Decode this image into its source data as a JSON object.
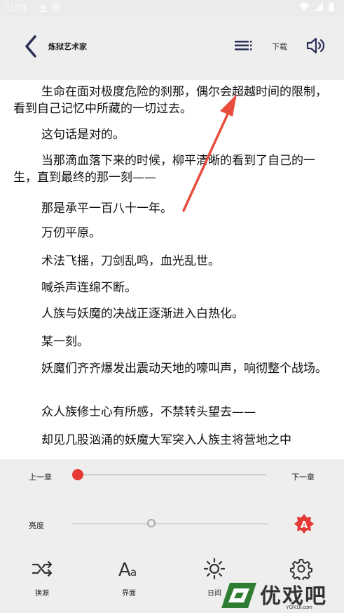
{
  "status_bar": {
    "time": "11:23"
  },
  "header": {
    "title": "炼狱艺术家",
    "download_label": "下载"
  },
  "content": {
    "paragraphs": [
      "生命在面对极度危险的刹那，偶尔会超越时间的限制，看到自己记忆中所藏的一切过去。",
      "这句话是对的。",
      "当那滴血落下来的时候，柳平清晰的看到了自己的一生，直到最终的那一刻——",
      "那是承平一百八十一年。",
      "万仞平原。",
      "术法飞摇，刀剑乱鸣，血光乱世。",
      "喊杀声连绵不断。",
      "人族与妖魔的决战正逐渐进入白热化。",
      "某一刻。",
      "妖魔们齐齐爆发出震动天地的嚎叫声，响彻整个战场。",
      "众人族修士心有所感，不禁转头望去——",
      "却见几股汹涌的妖魔大军突入人族主将营地之中"
    ]
  },
  "panel": {
    "prev_chapter": "上一章",
    "next_chapter": "下一章",
    "chapter_progress": 0,
    "brightness_label": "亮度",
    "brightness_level": 0.4,
    "tools": [
      {
        "label": "换源",
        "icon": "shuffle-icon"
      },
      {
        "label": "界面",
        "icon": "font-icon"
      },
      {
        "label": "日间",
        "icon": "sun-icon"
      },
      {
        "label": "",
        "icon": "gear-icon"
      }
    ]
  },
  "watermark": {
    "text": "优戏吧",
    "url": "YOX18.com"
  },
  "colors": {
    "accent": "#e53935",
    "primary_icon": "#2a2f55",
    "annotation": "#e84d3c"
  }
}
